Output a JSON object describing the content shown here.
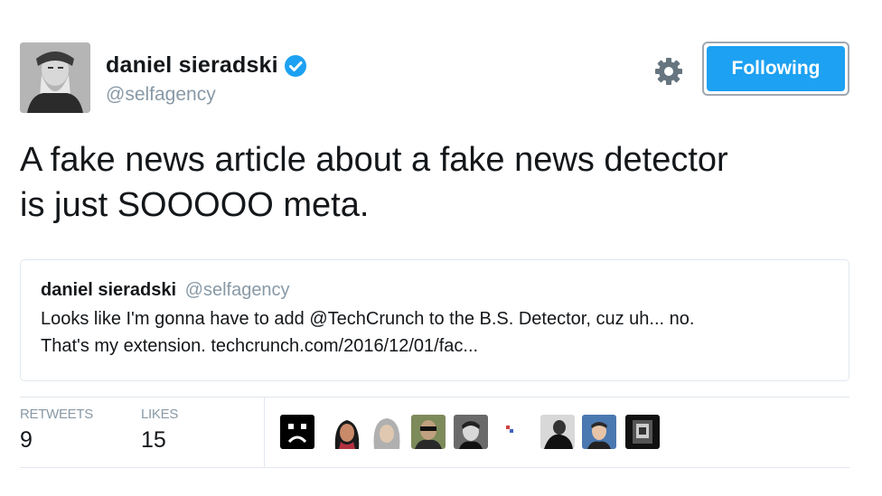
{
  "author": {
    "name": "daniel sieradski",
    "handle": "@selfagency",
    "verified_icon": "verified-badge-icon",
    "avatar_icon": "bearded-man-portrait"
  },
  "settings_icon": "gear-icon",
  "follow_button": {
    "label": "Following",
    "color": "#1da1f2"
  },
  "tweet": {
    "line1": "A fake news article about a fake news detector",
    "line2": "is just SOOOOO meta."
  },
  "quote": {
    "name": "daniel sieradski",
    "handle": "@selfagency",
    "line1": "Looks like I'm gonna have to add @TechCrunch to the B.S. Detector, cuz uh... no.",
    "line2": "That's my extension. techcrunch.com/2016/12/01/fac..."
  },
  "stats": {
    "retweets_label": "RETWEETS",
    "retweets_value": "9",
    "likes_label": "LIKES",
    "likes_value": "15"
  },
  "likers": [
    "liker-avatar-sad-face",
    "liker-avatar-woman",
    "liker-avatar-gray-hair",
    "liker-avatar-sunglasses",
    "liker-avatar-bw-portrait",
    "liker-avatar-small-logo",
    "liker-avatar-dark-figure",
    "liker-avatar-blue-photo",
    "liker-avatar-monochrome"
  ],
  "colors": {
    "accent": "#1da1f2",
    "muted": "#8899a6",
    "border": "#e1e8ed"
  }
}
